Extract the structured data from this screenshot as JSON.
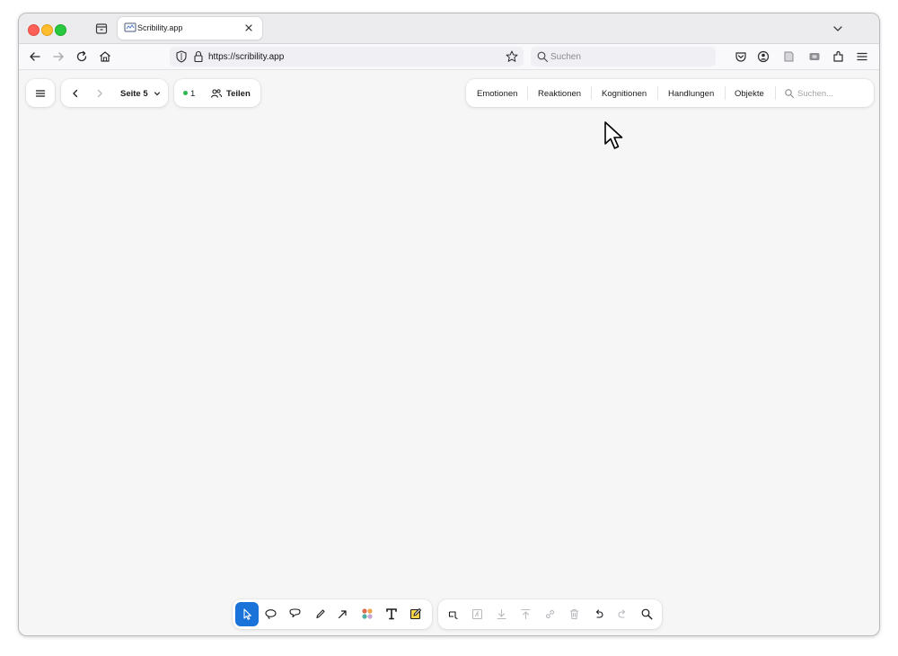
{
  "browser": {
    "tab": {
      "title": "Scribility.app",
      "favicon": "scribility-favicon"
    },
    "url": "https://scribility.app",
    "search_placeholder": "Suchen"
  },
  "app": {
    "page_nav": {
      "label": "Seite 5"
    },
    "presence": {
      "count": "1",
      "status_color": "#2db84d"
    },
    "share": {
      "label": "Teilen"
    },
    "categories": [
      "Emotionen",
      "Reaktionen",
      "Kognitionen",
      "Handlungen",
      "Objekte"
    ],
    "category_search_placeholder": "Suchen...",
    "toolbar": {
      "tools": [
        "select-pointer-icon",
        "lasso-icon",
        "speech-bubble-icon",
        "pencil-icon",
        "arrow-icon",
        "color-dots-icon",
        "text-tool-icon",
        "sticky-note-icon"
      ],
      "actions": [
        "crop-icon",
        "image-icon",
        "download-icon",
        "upload-icon",
        "link-icon",
        "trash-icon",
        "undo-icon",
        "redo-icon",
        "zoom-icon"
      ],
      "active_tool": "select-pointer-icon",
      "accent_color": "#1a73d9"
    }
  }
}
